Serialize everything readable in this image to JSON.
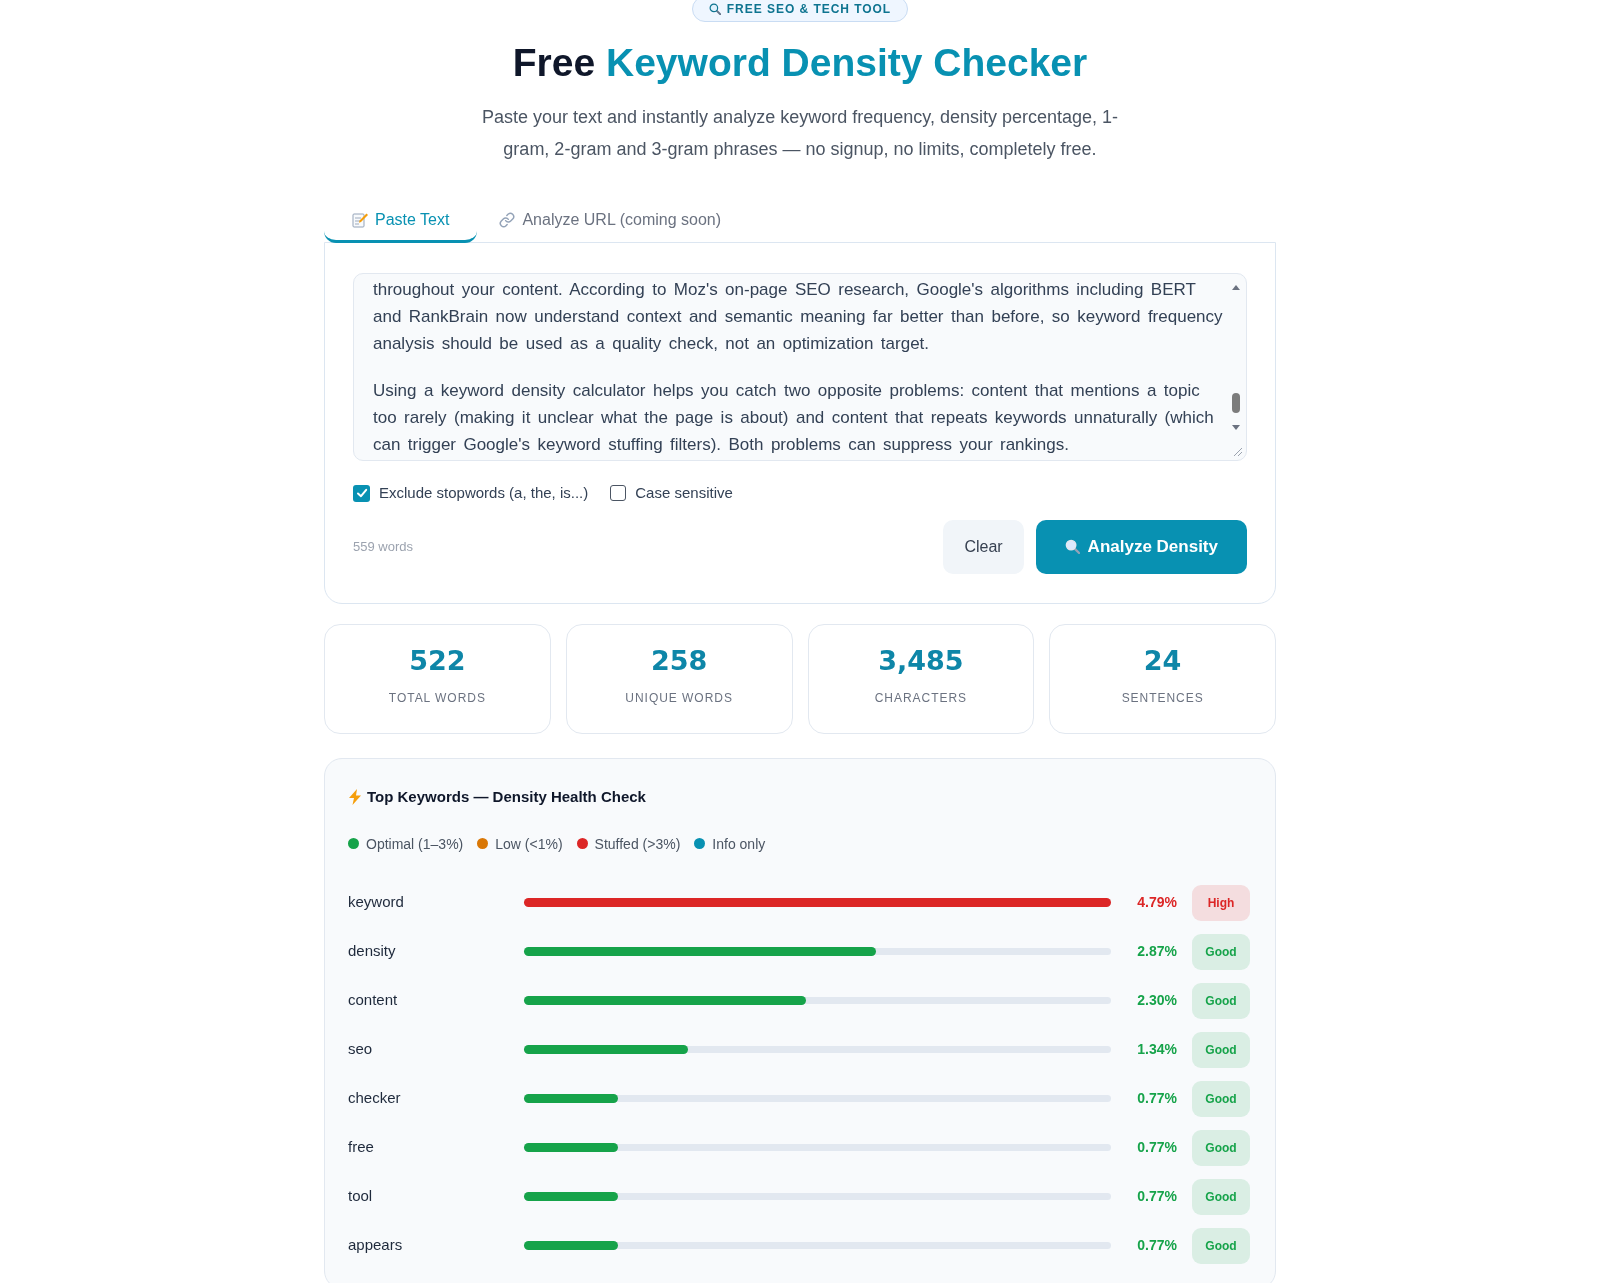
{
  "badge": {
    "text": "FREE SEO & TECH TOOL"
  },
  "title": {
    "lead": "Free",
    "highlight": "Keyword Density Checker"
  },
  "subtitle": "Paste your text and instantly analyze keyword frequency, density percentage, 1-gram, 2-gram and 3-gram phrases — no signup, no limits, completely free.",
  "tabs": [
    {
      "label": "Paste Text",
      "selected": true
    },
    {
      "label": "Analyze URL (coming soon)",
      "selected": false
    }
  ],
  "editor": {
    "paragraphs": [
      "throughout your content. According to Moz's on-page SEO research, Google's algorithms including BERT and RankBrain now understand context and semantic meaning far better than before, so keyword frequency analysis should be used as a quality check, not an optimization target.",
      "Using a keyword density calculator helps you catch two opposite problems: content that mentions a topic too rarely (making it unclear what the page is about) and content that repeats keywords unnaturally (which can trigger Google's keyword stuffing filters). Both problems can suppress your rankings."
    ]
  },
  "options": [
    {
      "label": "Exclude stopwords (a, the, is...)",
      "checked": true
    },
    {
      "label": "Case sensitive",
      "checked": false
    }
  ],
  "word_count": "559 words",
  "buttons": [
    {
      "label": "Clear",
      "kind": "secondary"
    },
    {
      "label": "Analyze Density",
      "kind": "primary"
    }
  ],
  "stats": [
    {
      "value": "522",
      "label": "TOTAL WORDS"
    },
    {
      "value": "258",
      "label": "UNIQUE WORDS"
    },
    {
      "value": "3,485",
      "label": "CHARACTERS"
    },
    {
      "value": "24",
      "label": "SENTENCES"
    }
  ],
  "keywords": {
    "title": "Top Keywords — Density Health Check",
    "legend": [
      {
        "label": "Optimal (1–3%)",
        "color": "#16a34a"
      },
      {
        "label": "Low (<1%)",
        "color": "#d97706"
      },
      {
        "label": "Stuffed (>3%)",
        "color": "#dc2626"
      },
      {
        "label": "Info only",
        "color": "#0891b2"
      }
    ],
    "rows": [
      {
        "keyword": "keyword",
        "level": 1,
        "percent": "4.79%",
        "status": "High",
        "color": "#dc2626"
      },
      {
        "keyword": "density",
        "level": 0.599,
        "percent": "2.87%",
        "status": "Good",
        "color": "#16a34a"
      },
      {
        "keyword": "content",
        "level": 0.48,
        "percent": "2.30%",
        "status": "Good",
        "color": "#16a34a"
      },
      {
        "keyword": "seo",
        "level": 0.28,
        "percent": "1.34%",
        "status": "Good",
        "color": "#16a34a"
      },
      {
        "keyword": "checker",
        "level": 0.16,
        "percent": "0.77%",
        "status": "Good",
        "color": "#16a34a"
      },
      {
        "keyword": "free",
        "level": 0.16,
        "percent": "0.77%",
        "status": "Good",
        "color": "#16a34a"
      },
      {
        "keyword": "tool",
        "level": 0.16,
        "percent": "0.77%",
        "status": "Good",
        "color": "#16a34a"
      },
      {
        "keyword": "appears",
        "level": 0.16,
        "percent": "0.77%",
        "status": "Good",
        "color": "#16a34a"
      }
    ]
  }
}
